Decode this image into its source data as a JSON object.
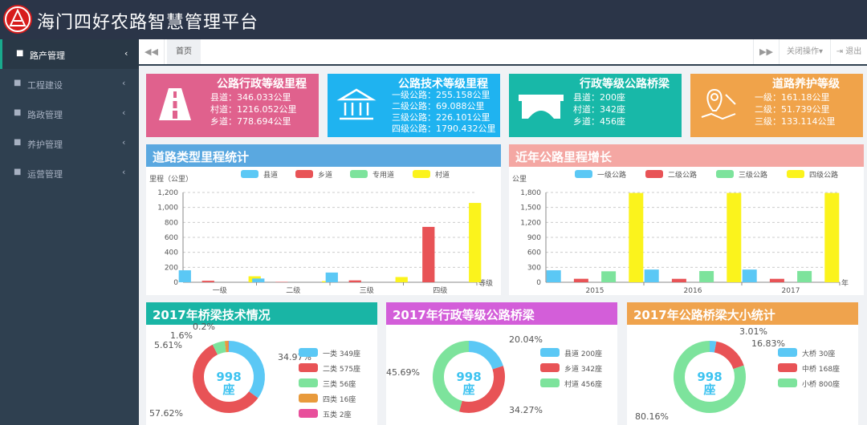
{
  "header": {
    "title": "海门四好农路智慧管理平台"
  },
  "sidebar": {
    "items": [
      {
        "label": "路产管理",
        "icon": "home-icon",
        "active": true
      },
      {
        "label": "工程建设",
        "icon": "home-icon"
      },
      {
        "label": "路政管理",
        "icon": "home-icon"
      },
      {
        "label": "养护管理",
        "icon": "home-icon"
      },
      {
        "label": "运营管理",
        "icon": "home-icon"
      }
    ],
    "arrow": "‹"
  },
  "tabbar": {
    "back": "◀◀",
    "home": "首页",
    "forward": "▶▶",
    "close": "关闭操作▾",
    "exit": "⇥ 退出"
  },
  "cards": [
    {
      "title": "公路行政等级里程",
      "lines": [
        "县道：346.033公里",
        "村道：1216.052公里",
        "乡道：778.694公里"
      ],
      "color": "#e0618d",
      "icon": "road-icon"
    },
    {
      "title": "公路技术等级里程",
      "lines": [
        "一级公路：255.158公里",
        "二级公路：69.088公里",
        "三级公路：226.101公里",
        "四级公路：1790.432公里"
      ],
      "color": "#1fb3f0",
      "icon": "building-icon"
    },
    {
      "title": "行政等级公路桥梁",
      "lines": [
        "县道：200座",
        "村道：342座",
        "乡道：456座"
      ],
      "color": "#18b8a8",
      "icon": "bridge-icon"
    },
    {
      "title": "道路养护等级",
      "lines": [
        "一级：161.18公里",
        "二级：51.739公里",
        "三级：133.114公里"
      ],
      "color": "#f0a34a",
      "icon": "map-pin-icon"
    }
  ],
  "panels": {
    "roadtype": {
      "title": "道路类型里程统计",
      "color": "#5aa8e0",
      "ylabel": "里程（公里）",
      "xunit": "等级"
    },
    "growth": {
      "title": "近年公路里程增长",
      "color": "#f4a7a3",
      "ylabel": "公里",
      "xunit": "年"
    },
    "tech": {
      "title": "2017年桥梁技术情况",
      "color": "#19b5a5"
    },
    "admin": {
      "title": "2017年行政等级公路桥梁",
      "color": "#d35ed9"
    },
    "size": {
      "title": "2017年公路桥梁大小统计",
      "color": "#efa34d"
    }
  },
  "chart_data": [
    {
      "type": "bar",
      "categories": [
        "一级",
        "二级",
        "三级",
        "四级"
      ],
      "series": [
        {
          "name": "县道",
          "values": [
            160,
            50,
            130,
            0
          ],
          "color": "#5bc8f5"
        },
        {
          "name": "乡道",
          "values": [
            20,
            5,
            25,
            740
          ],
          "color": "#e85356"
        },
        {
          "name": "专用道",
          "values": [
            0,
            0,
            0,
            0
          ],
          "color": "#7de39c"
        },
        {
          "name": "村道",
          "values": [
            80,
            15,
            70,
            1060
          ],
          "color": "#fbf31c"
        }
      ],
      "ylim": [
        0,
        1200
      ],
      "yticks": [
        "0",
        "200",
        "400",
        "600",
        "800",
        "1,000",
        "1,200"
      ]
    },
    {
      "type": "bar",
      "categories": [
        "2015",
        "2016",
        "2017"
      ],
      "series": [
        {
          "name": "一级公路",
          "values": [
            240,
            255,
            255
          ],
          "color": "#5bc8f5"
        },
        {
          "name": "二级公路",
          "values": [
            70,
            69,
            69
          ],
          "color": "#e85356"
        },
        {
          "name": "三级公路",
          "values": [
            220,
            225,
            226
          ],
          "color": "#7de39c"
        },
        {
          "name": "四级公路",
          "values": [
            1790,
            1790,
            1790
          ],
          "color": "#fbf31c"
        }
      ],
      "ylim": [
        0,
        1800
      ],
      "yticks": [
        "0",
        "300",
        "600",
        "900",
        "1,200",
        "1,500",
        "1,800"
      ]
    },
    {
      "type": "pie",
      "center": [
        "998",
        "座"
      ],
      "labels": [
        "一类",
        "二类",
        "三类",
        "四类",
        "五类"
      ],
      "values": [
        349,
        575,
        56,
        16,
        2
      ],
      "legend": [
        "一类  349座",
        "二类  575座",
        "三类  56座",
        "四类  16座",
        "五类  2座"
      ],
      "percents": [
        "34.97%",
        "57.62%",
        "5.61%",
        "1.6%",
        "0.2%"
      ],
      "colors": [
        "#5bc8f5",
        "#e85356",
        "#7de39c",
        "#e89a3c",
        "#e84f9b"
      ]
    },
    {
      "type": "pie",
      "center": [
        "998",
        "座"
      ],
      "labels": [
        "县道",
        "乡道",
        "村道"
      ],
      "values": [
        200,
        342,
        456
      ],
      "legend": [
        "县道  200座",
        "乡道  342座",
        "村道  456座"
      ],
      "percents": [
        "20.04%",
        "34.27%",
        "45.69%"
      ],
      "colors": [
        "#5bc8f5",
        "#e85356",
        "#7de39c"
      ]
    },
    {
      "type": "pie",
      "center": [
        "998",
        "座"
      ],
      "labels": [
        "大桥",
        "中桥",
        "小桥"
      ],
      "values": [
        30,
        168,
        800
      ],
      "legend": [
        "大桥  30座",
        "中桥  168座",
        "小桥  800座"
      ],
      "percents": [
        "3.01%",
        "16.83%",
        "80.16%"
      ],
      "colors": [
        "#5bc8f5",
        "#e85356",
        "#7de39c"
      ]
    }
  ]
}
